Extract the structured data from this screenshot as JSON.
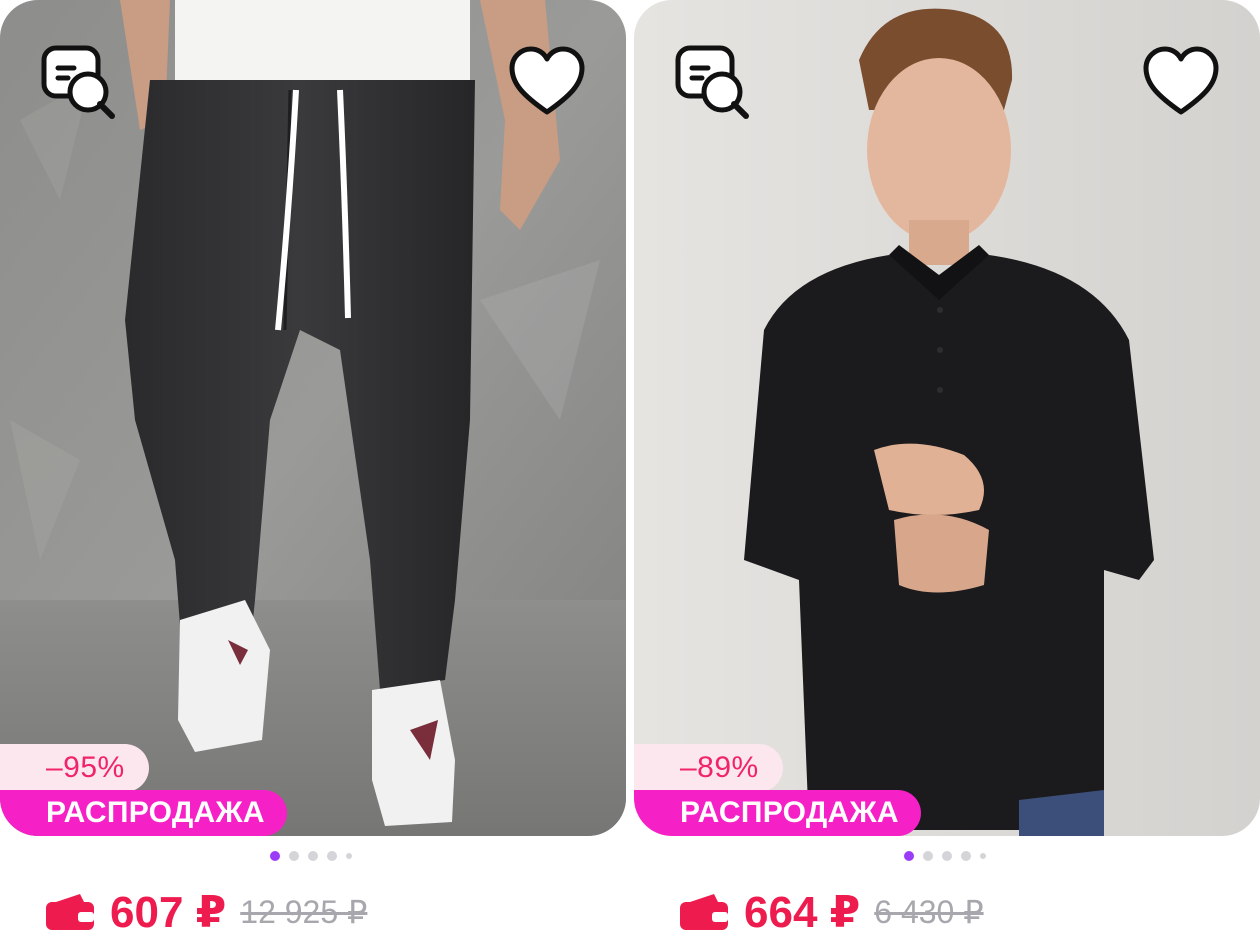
{
  "products": [
    {
      "discount": "–95%",
      "sale_label": "РАСПРОДАЖА",
      "price": "607 ₽",
      "old_price": "12 925 ₽",
      "gallery_dots": 5,
      "gallery_active": 0
    },
    {
      "discount": "–89%",
      "sale_label": "РАСПРОДАЖА",
      "price": "664 ₽",
      "old_price": "6 430 ₽",
      "gallery_dots": 5,
      "gallery_active": 0
    }
  ],
  "icons": {
    "similar": "similar-search-icon",
    "favorite": "heart-icon",
    "wallet": "wallet-icon"
  },
  "colors": {
    "price": "#ee1c4e",
    "sale_badge": "#f520c6",
    "discount_bg": "#fde7ee",
    "discount_text": "#f0246a",
    "dot_active": "#9b3cf6",
    "old_price": "#a7a7ad"
  }
}
